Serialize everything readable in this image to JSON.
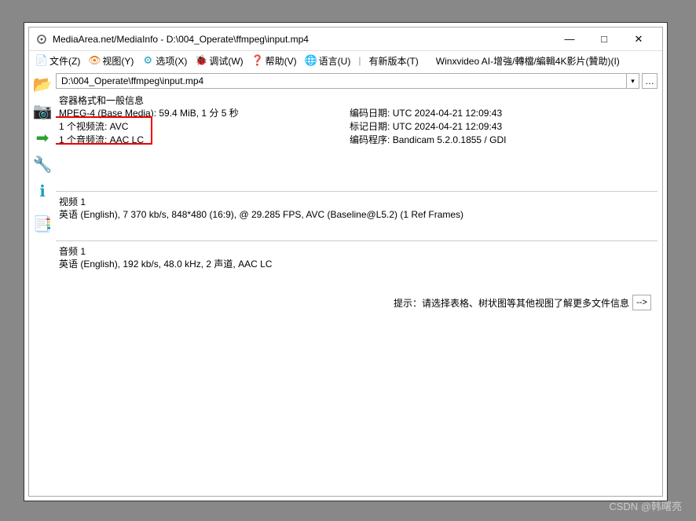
{
  "title": "MediaArea.net/MediaInfo - D:\\004_Operate\\ffmpeg\\input.mp4",
  "menu": {
    "file": "文件(Z)",
    "view": "视图(Y)",
    "options": "选项(X)",
    "debug": "调试(W)",
    "help": "帮助(V)",
    "lang": "语言(U)",
    "newver": "有新版本(T)",
    "sponsor": "Winxvideo AI-增強/轉檔/編輯4K影片(贊助)(I)"
  },
  "path": "D:\\004_Operate\\ffmpeg\\input.mp4",
  "general": {
    "header": "容器格式和一般信息",
    "container": "MPEG-4 (Base Media): 59.4 MiB, 1 分 5 秒",
    "video_stream": "1 个视频流: AVC",
    "audio_stream": "1 个音频流: AAC LC",
    "encoded_date_label": "编码日期:",
    "encoded_date": "UTC 2024-04-21 12:09:43",
    "tagged_date_label": "标记日期:",
    "tagged_date": "UTC 2024-04-21 12:09:43",
    "encoder_label": "编码程序:",
    "encoder": "Bandicam 5.2.0.1855 / GDI"
  },
  "video": {
    "header": "视频 1",
    "detail": "英语 (English), 7 370 kb/s, 848*480 (16:9), @ 29.285 FPS, AVC (Baseline@L5.2) (1 Ref Frames)"
  },
  "audio": {
    "header": "音频 1",
    "detail": "英语 (English), 192 kb/s, 48.0 kHz, 2 声道, AAC LC"
  },
  "hint": "提示：请选择表格、树状图等其他视图了解更多文件信息",
  "hint_btn": "-->",
  "watermark": "CSDN @韩曙亮"
}
